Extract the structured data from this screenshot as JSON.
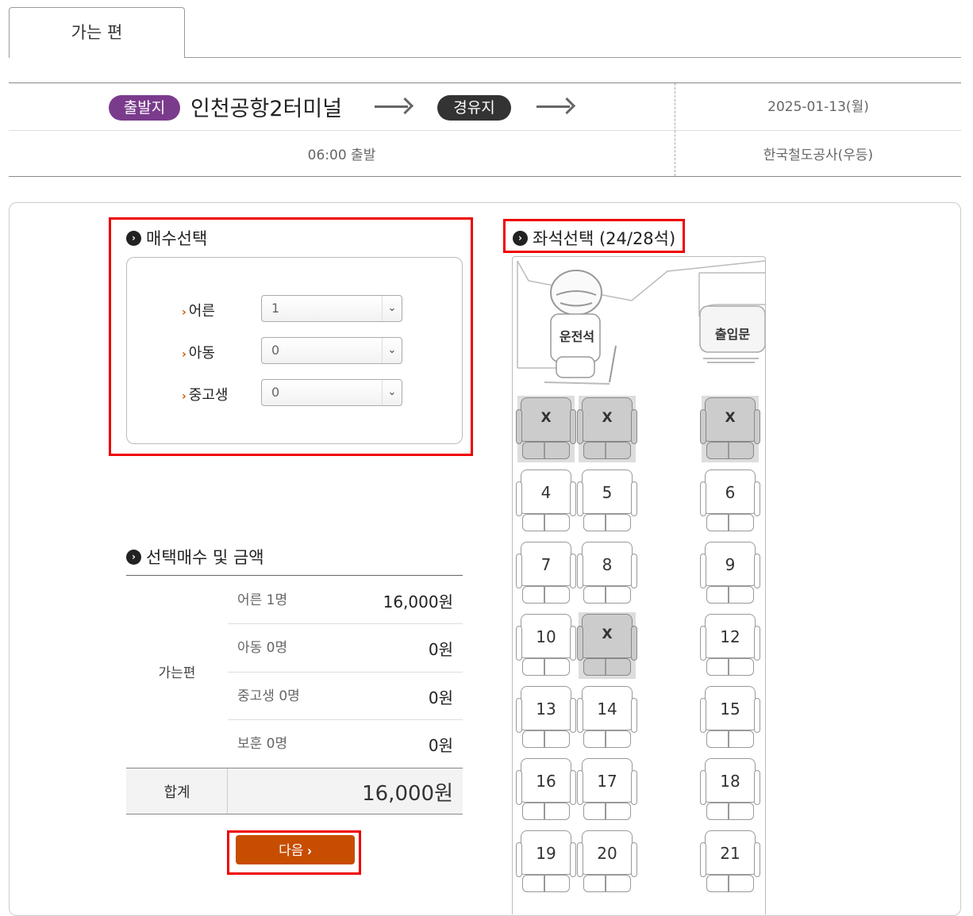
{
  "tab": {
    "label": "가는 편"
  },
  "route": {
    "departure_badge": "출발지",
    "terminal": "인천공항2터미널",
    "via_badge": "경유지",
    "date": "2025-01-13(월)",
    "time": "06:00 출발",
    "carrier": "한국철도공사(우등)"
  },
  "qty": {
    "title": "매수선택",
    "rows": [
      {
        "label": "어른",
        "value": "1"
      },
      {
        "label": "아동",
        "value": "0"
      },
      {
        "label": "중고생",
        "value": "0"
      }
    ]
  },
  "seat_section": {
    "title": "좌석선택 (24/28석)",
    "driver": "운전석",
    "door": "출입문",
    "seats": [
      {
        "num": "X",
        "taken": true
      },
      {
        "num": "X",
        "taken": true
      },
      {
        "num": "X",
        "taken": true
      },
      {
        "num": "4",
        "taken": false
      },
      {
        "num": "5",
        "taken": false
      },
      {
        "num": "6",
        "taken": false
      },
      {
        "num": "7",
        "taken": false
      },
      {
        "num": "8",
        "taken": false
      },
      {
        "num": "9",
        "taken": false
      },
      {
        "num": "10",
        "taken": false
      },
      {
        "num": "X",
        "taken": true
      },
      {
        "num": "12",
        "taken": false
      },
      {
        "num": "13",
        "taken": false
      },
      {
        "num": "14",
        "taken": false
      },
      {
        "num": "15",
        "taken": false
      },
      {
        "num": "16",
        "taken": false
      },
      {
        "num": "17",
        "taken": false
      },
      {
        "num": "18",
        "taken": false
      },
      {
        "num": "19",
        "taken": false
      },
      {
        "num": "20",
        "taken": false
      },
      {
        "num": "21",
        "taken": false
      }
    ]
  },
  "summary": {
    "title": "선택매수 및 금액",
    "direction": "가는편",
    "rows": [
      {
        "label": "어른 1명",
        "value": "16,000원"
      },
      {
        "label": "아동 0명",
        "value": "0원"
      },
      {
        "label": "중고생 0명",
        "value": "0원"
      },
      {
        "label": "보훈 0명",
        "value": "0원"
      }
    ],
    "total_label": "합계",
    "total_value": "16,000원"
  },
  "next_button": {
    "label": "다음"
  }
}
